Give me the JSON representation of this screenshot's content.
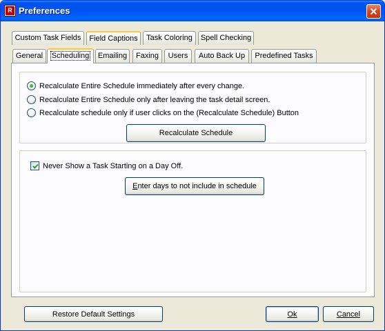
{
  "window": {
    "title": "Preferences"
  },
  "tabs_row1": [
    {
      "label": "Custom Task Fields"
    },
    {
      "label": "Field Captions"
    },
    {
      "label": "Task Coloring"
    },
    {
      "label": "Spell Checking"
    }
  ],
  "tabs_row2": [
    {
      "label": "General"
    },
    {
      "label": "Scheduling"
    },
    {
      "label": "Emailing"
    },
    {
      "label": "Faxing"
    },
    {
      "label": "Users"
    },
    {
      "label": "Auto Back Up"
    },
    {
      "label": "Predefined Tasks"
    }
  ],
  "selected_tab": "Scheduling",
  "recalc": {
    "options": [
      {
        "label": "Recalculate Entire Schedule immediately after every change.",
        "checked": true
      },
      {
        "label": "Recalculate Entire Schedule only after leaving the task detail screen.",
        "checked": false
      },
      {
        "label": "Recalculate schedule only if user clicks on the (Recalculate Schedule) Button",
        "checked": false
      }
    ],
    "button_label": "Recalculate Schedule"
  },
  "days_off": {
    "checkbox_label": "Never Show a Task Starting on a Day Off.",
    "checked": true,
    "button_label_accel": "E",
    "button_label_rest": "nter days to not include in schedule"
  },
  "footer": {
    "restore_label": "Restore Default Settings",
    "ok_label": "Ok",
    "cancel_label": "Cancel"
  },
  "colors": {
    "title_bar": "#0054e3",
    "dialog_bg": "#ece9d8",
    "tab_highlight": "#ffc83c",
    "radio_checked": "#21a121",
    "close_button": "#d9441b"
  }
}
